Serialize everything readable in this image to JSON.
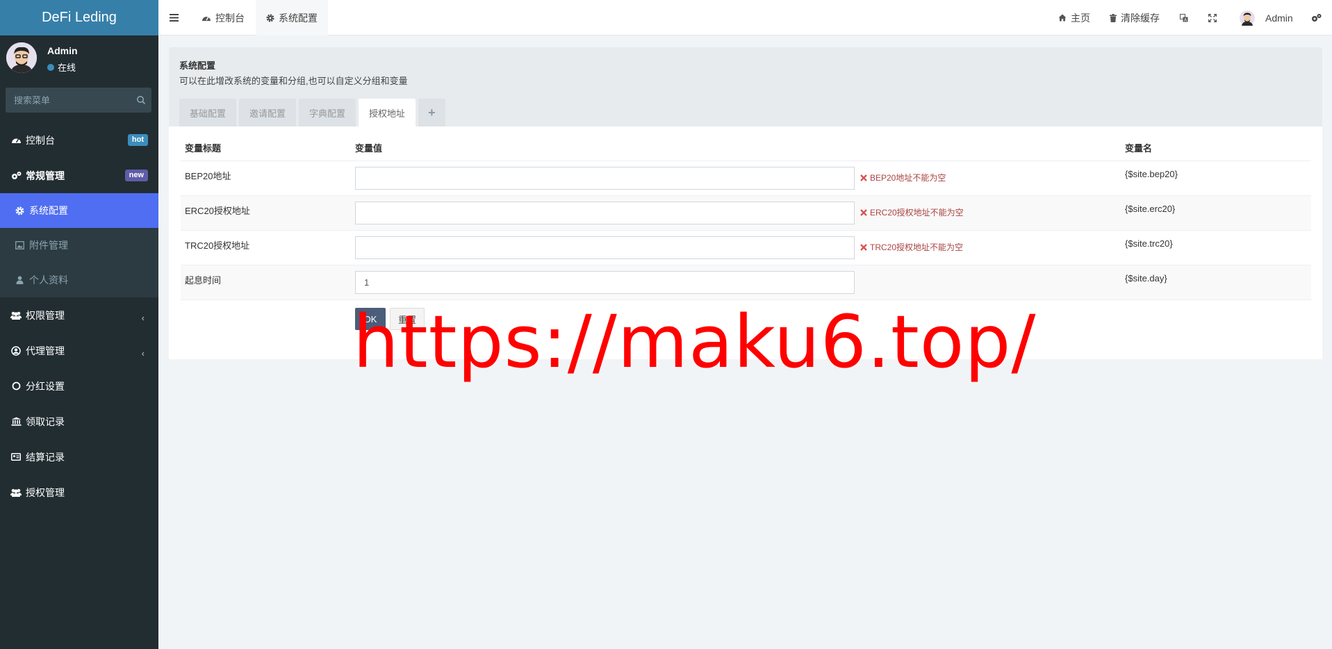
{
  "brand": "DeFi Leding",
  "user": {
    "name": "Admin",
    "status": "在线"
  },
  "search": {
    "placeholder": "搜索菜单"
  },
  "menu": {
    "dashboard": {
      "label": "控制台",
      "badge": "hot"
    },
    "general": {
      "label": "常规管理",
      "badge": "new"
    },
    "sub": [
      {
        "label": "系统配置"
      },
      {
        "label": "附件管理"
      },
      {
        "label": "个人资料"
      }
    ],
    "auth": {
      "label": "权限管理"
    },
    "agent": {
      "label": "代理管理"
    },
    "dividend": {
      "label": "分红设置"
    },
    "claims": {
      "label": "领取记录"
    },
    "settlement": {
      "label": "结算记录"
    },
    "authorization": {
      "label": "授权管理"
    }
  },
  "navbar": {
    "tabs": [
      {
        "label": "控制台"
      },
      {
        "label": "系统配置"
      }
    ],
    "home": "主页",
    "clear_cache": "清除缓存",
    "user": "Admin"
  },
  "page": {
    "title": "系统配置",
    "description": "可以在此增改系统的变量和分组,也可以自定义分组和变量",
    "tabs": [
      "基础配置",
      "邀请配置",
      "字典配置",
      "授权地址",
      "+"
    ],
    "columns": {
      "title": "变量标题",
      "value": "变量值",
      "name": "变量名"
    },
    "rows": [
      {
        "title": "BEP20地址",
        "value": "",
        "error": "BEP20地址不能为空",
        "var": "{$site.bep20}"
      },
      {
        "title": "ERC20授权地址",
        "value": "",
        "error": "ERC20授权地址不能为空",
        "var": "{$site.erc20}"
      },
      {
        "title": "TRC20授权地址",
        "value": "",
        "error": "TRC20授权地址不能为空",
        "var": "{$site.trc20}"
      },
      {
        "title": "起息时间",
        "value": "1",
        "error": "",
        "var": "{$site.day}"
      }
    ],
    "ok_button": "OK",
    "reset_button": "重置"
  },
  "watermark": "https://maku6.top/"
}
